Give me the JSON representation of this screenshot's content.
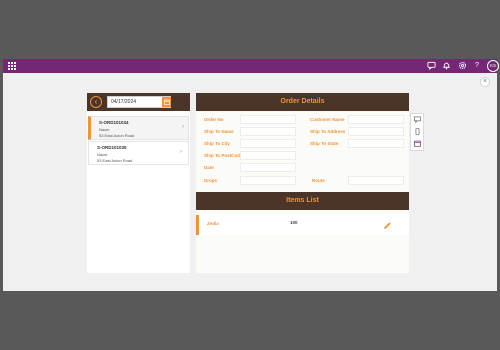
{
  "header": {
    "avatar_initials": "KS"
  },
  "nav": {
    "back_glyph": "‹",
    "date_value": "04/17/2024"
  },
  "orders": [
    {
      "id": "S-ORD101034",
      "name": "Nacer",
      "address": "53 East Acton Road",
      "selected": true
    },
    {
      "id": "S-ORD101035",
      "name": "Nacer",
      "address": "53 East Acton Road",
      "selected": false
    }
  ],
  "order_details": {
    "title": "Order Details",
    "labels": {
      "order_no": "Order No",
      "customer_name": "Customer Name",
      "ship_to_name": "Ship To Name",
      "ship_to_address": "Ship To Address",
      "ship_to_city": "Ship To City",
      "ship_to_state": "Ship To State",
      "ship_to_postcode": "Ship To PostCode",
      "date": "Date",
      "drops": "Drops",
      "route": "Route"
    }
  },
  "items_list": {
    "title": "Items List",
    "items": [
      {
        "name": "Zedia",
        "qty": "100"
      }
    ]
  },
  "icons": {
    "app_launcher": "waffle-icon",
    "chat": "chat-icon",
    "notifications": "bell-icon",
    "settings": "gear-icon",
    "help": "help-icon",
    "close": "close-icon",
    "back": "back-arrow-icon",
    "calendar": "calendar-icon",
    "edit": "pencil-icon"
  },
  "colors": {
    "app_bar": "#742774",
    "header_brown": "#4b3428",
    "accent_orange": "#f0923a",
    "backdrop": "#595959"
  }
}
